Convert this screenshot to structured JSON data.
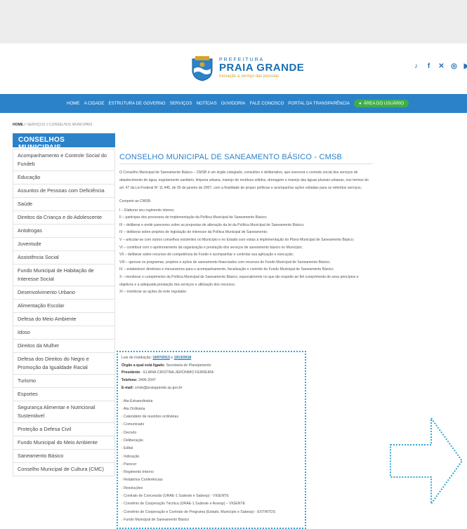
{
  "header": {
    "logo_small": "PREFEITURA",
    "logo_big": "PRAIA GRANDE",
    "logo_tag": "Inovação a serviço das pessoas",
    "social_icons": [
      "tiktok-icon",
      "facebook-icon",
      "x-icon",
      "instagram-icon",
      "youtube-icon"
    ],
    "brand_color": "#2b82c9"
  },
  "nav": {
    "items": [
      "HOME",
      "A CIDADE",
      "ESTRUTURA DE GOVERNO",
      "SERVIÇOS",
      "NOTÍCIAS",
      "OUVIDORIA",
      "FALE CONOSCO",
      "PORTAL DA TRANSPARÊNCIA"
    ],
    "user_area": "ÁREA DO USUÁRIO",
    "user_color": "#3fae49"
  },
  "breadcrumb": {
    "home": "HOME",
    "sep1": " // ",
    "services": "SERVIÇOS",
    "sep2": " // ",
    "current": "CONSELHOS MUNICIPAIS"
  },
  "sidebar": {
    "title": "CONSELHOS MUNICIPAIS",
    "items": [
      "Acompanhamento e Controle Social do Fundeb",
      "Educação",
      "Assuntos de Pessoas com Deficiência",
      "Saúde",
      "Direitos da Criança e do Adolescente",
      "Antidrogas",
      "Juventude",
      "Assistência Social",
      "Fundo Municipal de Habitação de Interesse Social",
      "Desenvolvimento Urbano",
      "Alimentação Escolar",
      "Defesa do Meio Ambiente",
      "Idoso",
      "Direitos da Mulher",
      "Defesa dos Direitos do Negro e Promoção da Igualdade Racial",
      "Turismo",
      "Esportes",
      "Segurança Alimentar e Nutricional Sustentável",
      "Proteção a Defesa Civil",
      "Fundo Municipal do Meio Ambiente",
      "Saneamento Básico",
      "Conselho Municipal de Cultura (CMC)"
    ]
  },
  "main": {
    "title": "CONSELHO MUNICIPAL DE SANEAMENTO BÁSICO - CMSB",
    "intro": "O Conselho Municipal de Saneamento Básico – CMSB é um órgão colegiado, consultivo e deliberativo, que exercerá o controle social dos serviços de abastecimento de água, esgotamento sanitário, limpeza urbana, manejo de resíduos sólidos, drenagem e manejo das águas pluviais urbanas, nos termos do art. 47 da Lei Federal Nº 11.445, de 05 de janeiro de 2007, com a finalidade de propor políticas e acompanhar ações voltadas para os referidos serviços;",
    "compete_title": "Compete ao CMSB:",
    "compete": [
      "I – Elaborar seu regimento interno;",
      "II – participar dos processos de implementação da Política Municipal de Saneamento Básico;",
      "III – deliberar e emitir pareceres sobre as propostas de alteração da lei da Política Municipal de Saneamento Básico;",
      "IV – deliberar sobre projetos de legislação de interesse da Política Municipal de Saneamento;",
      "V – articular-se com outros conselhos existentes no Município e no Estado com vistas à implementação do Plano Municipal de Saneamento Básico;",
      "VI – contribuir com o aprimoramento da organização e prestação dos serviços de saneamento básico no Município;",
      "VII – deliberar sobre recursos de competência do Fundo e acompanhar e controlar sua aplicação e execução;",
      "VIII – aprovar os programas, projetos e ações de saneamento financiados com recursos do Fundo Municipal de Saneamento Básico;",
      "IX – estabelecer diretrizes e mecanismos para o acompanhamento, fiscalização e controle do Fundo Municipal de Saneamento Básico;",
      "X – monitorar o cumprimento da Política Municipal de Saneamento Básico, especialmente no que diz respeito ao fiel cumprimento de seus princípios e objetivos e a adequada prestação dos serviços e utilização dos recursos;",
      "XI – monitorar as ações do ente regulador."
    ]
  },
  "info": {
    "law_label": "Leis de Instituição:",
    "law_1": "1697/2013",
    "law_sep": " e ",
    "law_2": "1913/2018",
    "organ_label": "Órgão a qual está ligado:",
    "organ_value": "Secretaria de Planejamento",
    "president_label": "Presidente",
    "president_value": " - ELIANA CRISTINA JERONIMO FERREIRA",
    "phone_label": "Telefone:",
    "phone_value": "3496-2047",
    "email_label": "E-mail:",
    "email_value": "cmsb@praiagrande.sp.gov.br",
    "docs": [
      "Ata Extraordinária",
      "Ata Ordinária",
      "Calendário de reuniões ordinárias",
      "Comunicado",
      "Decreto",
      "Deliberação",
      "Edital",
      "Indicação",
      "Parecer",
      "Regimento Interno",
      "Relatórios Conferências",
      "Resoluções",
      "Contrato de Concessão (URAE-1 Sudeste e Sabesp) - VIGENTE",
      "Convênio de Cooperação Técnica (URAE-1 Sudeste e Arsesp) – VIGENTE",
      "Convênio de Cooperação e Contrato de Programa (Estado, Município e Sabesp) - EXTINTOS",
      "Fundo Municipal de Saneamento Básico"
    ],
    "border_color": "#31a6d2"
  }
}
